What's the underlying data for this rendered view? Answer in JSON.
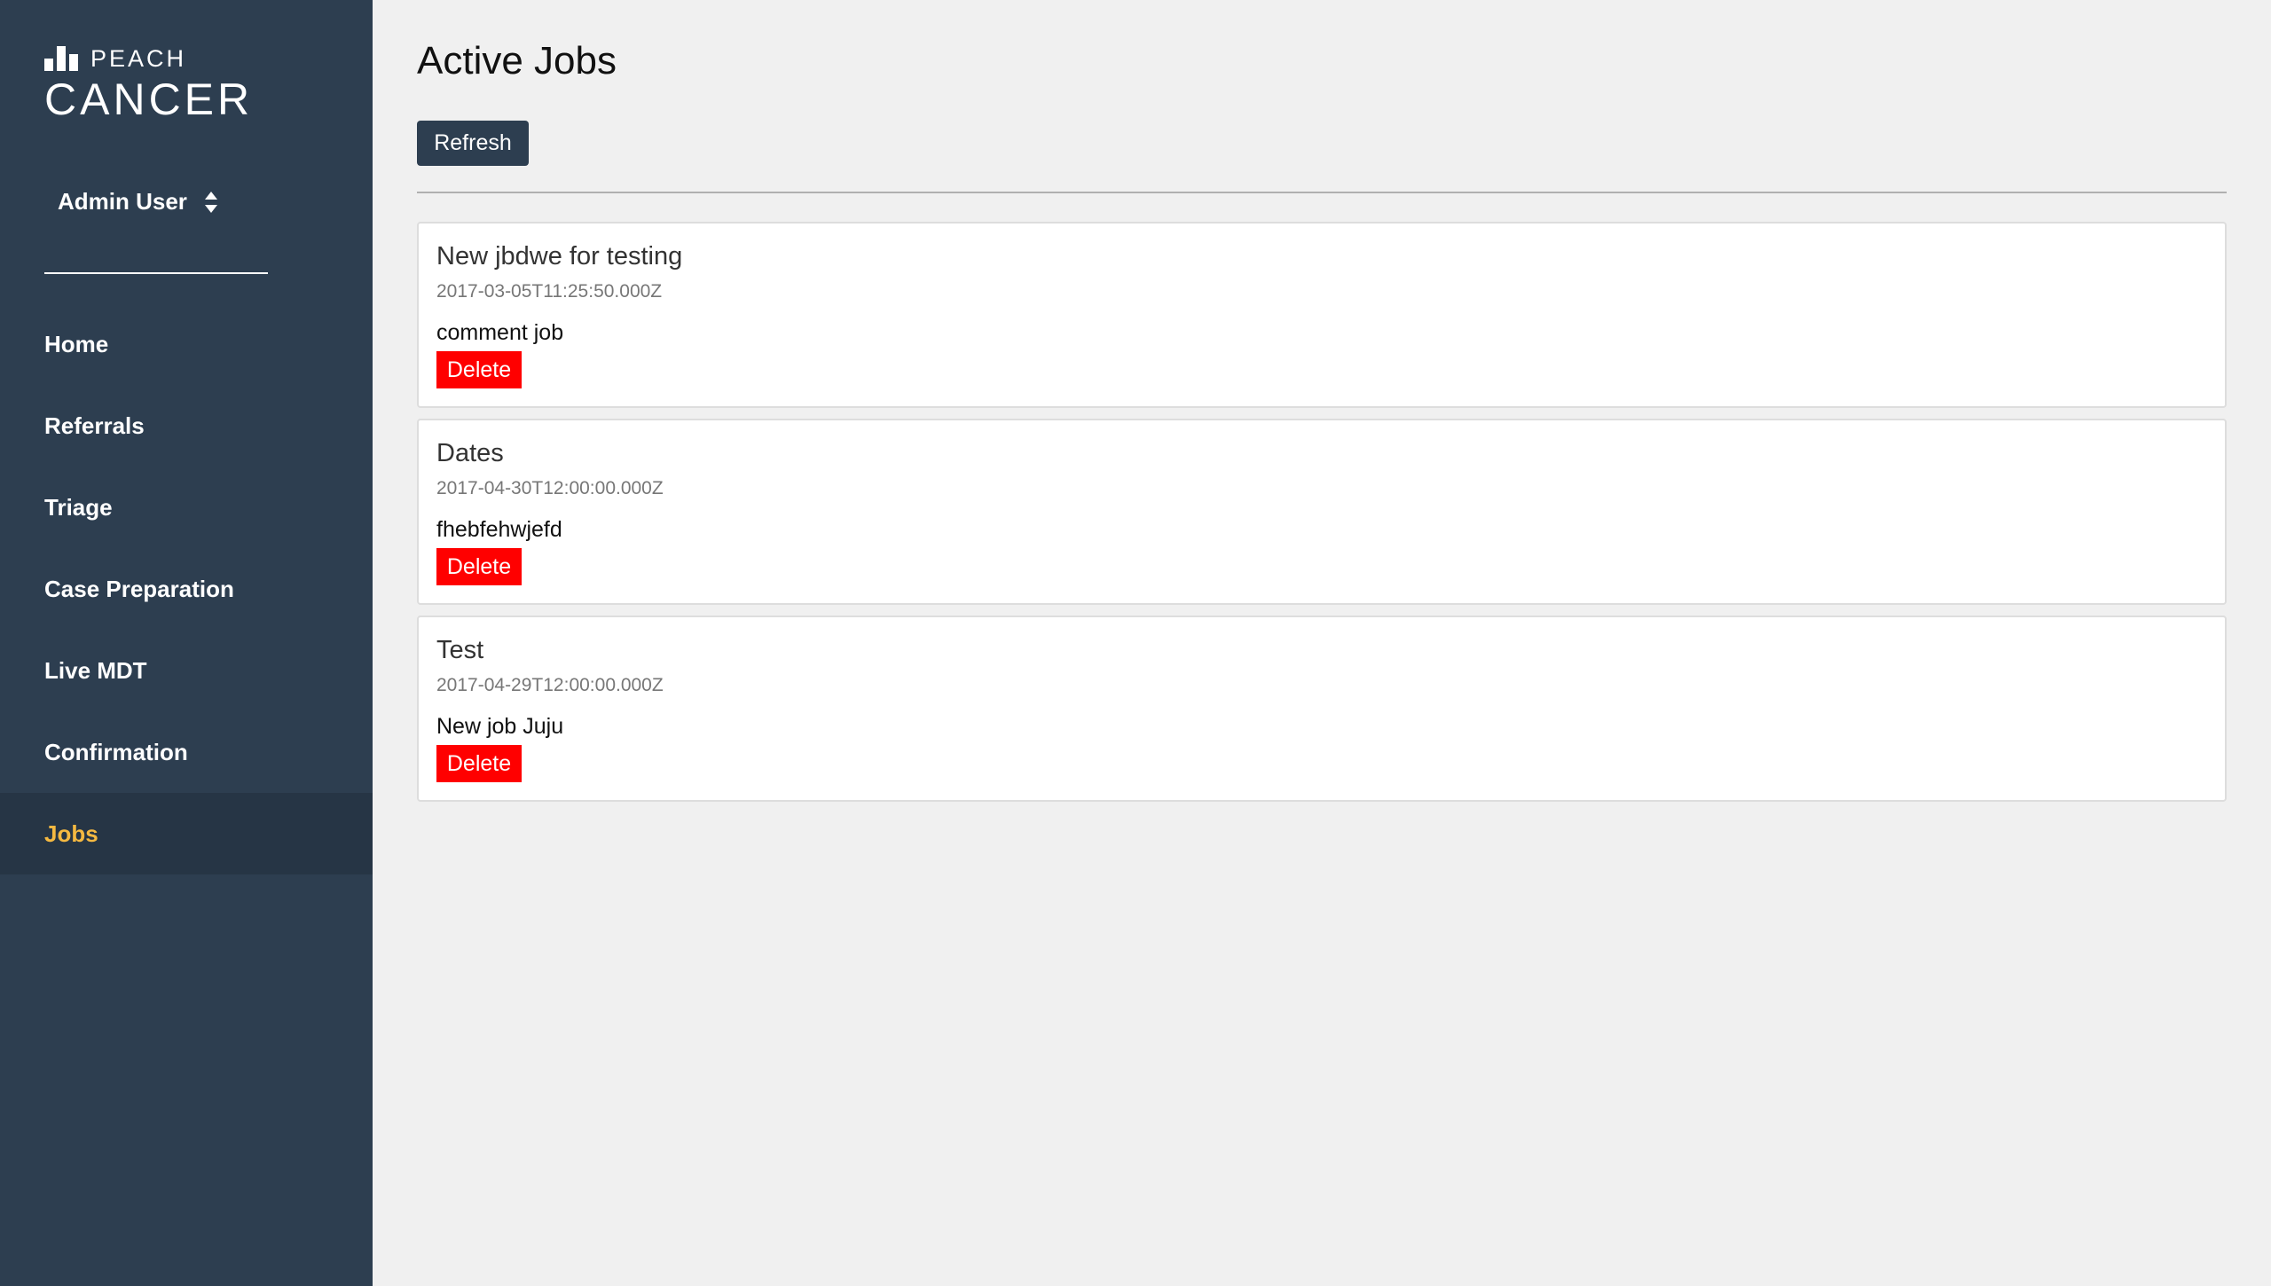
{
  "brand": {
    "small_text": "PEACH",
    "large_text": "CANCER",
    "logo_icon": "bar-chart-logo-icon"
  },
  "user_menu": {
    "label": "Admin User",
    "icon": "sort-arrows-icon"
  },
  "nav": {
    "items": [
      {
        "label": "Home",
        "active": false
      },
      {
        "label": "Referrals",
        "active": false
      },
      {
        "label": "Triage",
        "active": false
      },
      {
        "label": "Case Preparation",
        "active": false
      },
      {
        "label": "Live MDT",
        "active": false
      },
      {
        "label": "Confirmation",
        "active": false
      },
      {
        "label": "Jobs",
        "active": true
      }
    ]
  },
  "main": {
    "title": "Active Jobs",
    "refresh_label": "Refresh"
  },
  "jobs": [
    {
      "title": "New jbdwe for testing",
      "date": "2017-03-05T11:25:50.000Z",
      "comment": "comment job",
      "delete_label": "Delete"
    },
    {
      "title": "Dates",
      "date": "2017-04-30T12:00:00.000Z",
      "comment": "fhebfehwjefd",
      "delete_label": "Delete"
    },
    {
      "title": "Test",
      "date": "2017-04-29T12:00:00.000Z",
      "comment": "New job Juju",
      "delete_label": "Delete"
    }
  ],
  "colors": {
    "sidebar_bg": "#2d3e50",
    "sidebar_active_bg": "#263545",
    "active_nav_text": "#f5b941",
    "page_bg": "#f0f0f0",
    "delete_button": "#ff0000"
  }
}
